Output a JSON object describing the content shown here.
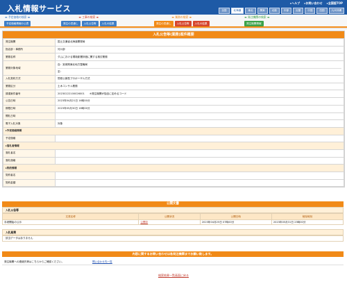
{
  "header": {
    "logo": "入札情報サービス",
    "links": [
      "▸ヘルプ",
      "▸お問い合わせ",
      "▸全国版TOP"
    ],
    "regions": [
      "全国",
      "北海道",
      "東北",
      "関東",
      "北陸",
      "中部",
      "近畿",
      "中国",
      "四国",
      "九州沖縄"
    ],
    "active_region": "北海道"
  },
  "nav": {
    "groups": [
      {
        "caption": "◂▸ 予定価格の検索 ◂▸",
        "color": "blue",
        "buttons": [
          {
            "label": "予定価格情報の公表",
            "color": "blue"
          }
        ]
      },
      {
        "caption": "◂▸ 工事の検索 ◂▸",
        "color": "red",
        "buttons": [
          {
            "label": "発注の見通し",
            "color": "blue"
          },
          {
            "label": "入札公告等",
            "color": "blue"
          },
          {
            "label": "入札の結果",
            "color": "blue"
          }
        ]
      },
      {
        "caption": "◂▸ 業務の検索 ◂▸",
        "color": "orange",
        "buttons": [
          {
            "label": "発注の見通し",
            "color": "orange"
          },
          {
            "label": "入札公告等",
            "color": "red"
          },
          {
            "label": "入札の結果",
            "color": "red"
          }
        ]
      },
      {
        "caption": "◂▸ 発注機関の検索 ◂▸",
        "color": "green",
        "buttons": [
          {
            "label": "発注機関情報",
            "color": "green"
          }
        ]
      }
    ]
  },
  "detail": {
    "title": "入札公告等(業務)案件概要",
    "rows": [
      {
        "label": "発注機関",
        "value": "国土交通省北海道開発局"
      },
      {
        "label": "指名部・事務所",
        "value": "河川部"
      },
      {
        "label": "業務名称",
        "value": "ダムにおける環境影響評価に関する検討業務"
      },
      {
        "label": "業務対象地域",
        "values": [
          "自：宮城県東北地方整備局",
          "至："
        ]
      },
      {
        "label": "入札契約方式",
        "value": "簡易公募型プロポーザル方式"
      },
      {
        "label": "業務区分",
        "value": "土木コンサル業務"
      },
      {
        "label": "調達案件番号",
        "value": "20230222100026001　　※発注機関が独自に定めるコード"
      },
      {
        "label": "公告日時",
        "value": "2023年04月21日 16時00分"
      },
      {
        "label": "期限日時",
        "value": "2023年05月30日 16時00分"
      },
      {
        "label": "開札日時",
        "value": ""
      },
      {
        "label": "電子入札対象",
        "value": "対象"
      },
      {
        "section": "▸予定価格情報"
      },
      {
        "label": "予定価格",
        "value": ""
      },
      {
        "section": "▸落札者情報"
      },
      {
        "label": "落札者名",
        "value": ""
      },
      {
        "label": "落札価格",
        "value": ""
      },
      {
        "section": "▸契約情報"
      },
      {
        "label": "契約者名",
        "value": ""
      },
      {
        "label": "契約金額",
        "value": ""
      }
    ]
  },
  "publications": {
    "heading": "公開文書",
    "notice_section": "入札公告等",
    "columns": [
      "文書名称",
      "公開状況",
      "公開日時",
      "削除時刻"
    ],
    "rows": [
      {
        "name": "手続開始の公示",
        "status": "公開中",
        "published": "2023年04月25日 07時00分",
        "deleted": "2023年05月31日 23時00分"
      }
    ],
    "result_section": "入札結果",
    "no_data": "該当データはありません"
  },
  "notice_bar": "内容に関するお問い合わせは各発注機関までお願い致します。",
  "contact": {
    "text": "発注機関への連絡先等はこちらからご確認ください。",
    "link": "問い合わせ先一覧"
  },
  "back_link": "検索結果一覧画面に戻る"
}
